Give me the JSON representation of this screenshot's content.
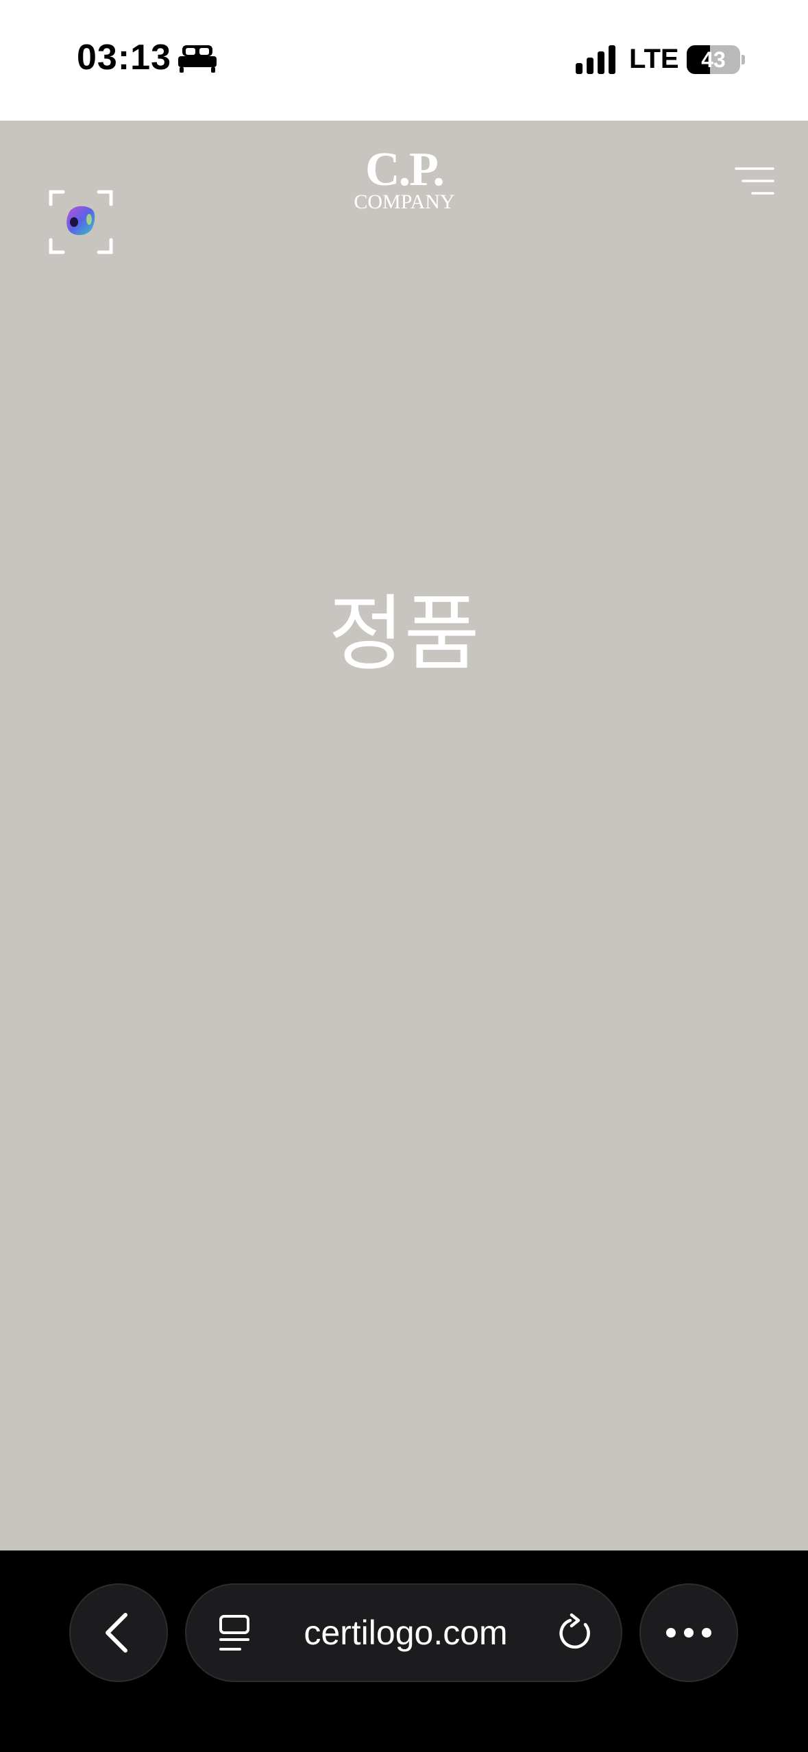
{
  "status_bar": {
    "time": "03:13",
    "sleep_icon": "bed-icon",
    "signal_icon": "cellular-signal-icon",
    "network": "LTE",
    "battery_level": "43",
    "battery_fraction": 0.43
  },
  "header": {
    "scan_icon": "scan-authenticate-icon",
    "logo_line1": "C.P.",
    "logo_line2": "COMPANY",
    "menu_icon": "hamburger-menu-icon"
  },
  "hero": {
    "text": "정품"
  },
  "browser": {
    "back_icon": "chevron-left-icon",
    "tabs_icon": "tabs-icon",
    "url": "certilogo.com",
    "reload_icon": "reload-icon",
    "more_icon": "more-dots-icon"
  },
  "colors": {
    "page_background": "#c8c5c0",
    "hero_text": "#ffffff",
    "browser_bar": "#000000",
    "browser_control": "#1c1c1e"
  }
}
